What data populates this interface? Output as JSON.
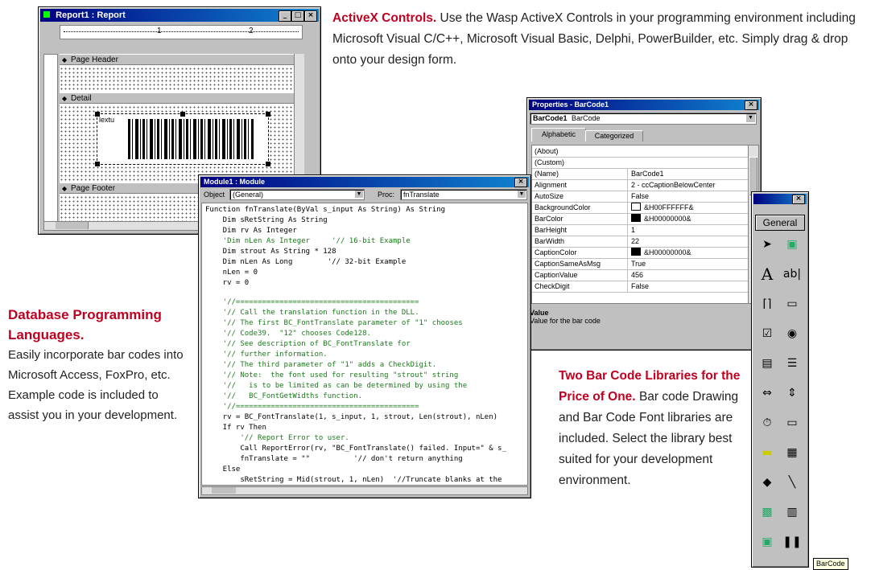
{
  "report_window": {
    "title": "Report1 : Report",
    "ruler_marks": [
      "1",
      "2"
    ],
    "sections": {
      "page_header": "Page Header",
      "detail": "Detail",
      "page_footer": "Page Footer"
    },
    "barcode_control_label": "lextu"
  },
  "activex": {
    "heading": "ActiveX Controls.",
    "text": "Use the Wasp ActiveX Controls in your programming environment including Microsoft Visual C/C++, Microsoft Visual Basic, Delphi, PowerBuilder, etc. Simply drag & drop onto your design form."
  },
  "module_window": {
    "title": "Module1 : Module",
    "object_label": "Object",
    "object_value": "(General)",
    "proc_label": "Proc:",
    "proc_value": "fnTranslate",
    "code_lines": [
      {
        "t": "Function fnTranslate(ByVal s_input As String) As String",
        "c": false
      },
      {
        "t": "    Dim sRetString As String",
        "c": false
      },
      {
        "t": "    Dim rv As Integer",
        "c": false
      },
      {
        "t": "    'Dim nLen As Integer     '// 16-bit Example",
        "c": true
      },
      {
        "t": "    Dim strout As String * 128",
        "c": false
      },
      {
        "t": "    Dim nLen As Long        '// 32-bit Example",
        "c": false
      },
      {
        "t": "    nLen = 0",
        "c": false
      },
      {
        "t": "    rv = 0",
        "c": false
      },
      {
        "t": "",
        "c": false
      },
      {
        "t": "    '//==========================================",
        "c": true
      },
      {
        "t": "    '// Call the translation function in the DLL.",
        "c": true
      },
      {
        "t": "    '// The first BC_FontTranslate parameter of \"1\" chooses",
        "c": true
      },
      {
        "t": "    '// Code39.  \"12\" chooses Code128.",
        "c": true
      },
      {
        "t": "    '// See description of BC_FontTranslate for",
        "c": true
      },
      {
        "t": "    '// further information.",
        "c": true
      },
      {
        "t": "    '// The third parameter of \"1\" adds a CheckDigit.",
        "c": true
      },
      {
        "t": "    '// Note:  the font used for resulting \"strout\" string",
        "c": true
      },
      {
        "t": "    '//   is to be limited as can be determined by using the",
        "c": true
      },
      {
        "t": "    '//   BC_FontGetWidths function.",
        "c": true
      },
      {
        "t": "    '//==========================================",
        "c": true
      },
      {
        "t": "    rv = BC_FontTranslate(1, s_input, 1, strout, Len(strout), nLen)",
        "c": false
      },
      {
        "t": "    If rv Then",
        "c": false
      },
      {
        "t": "        '// Report Error to user.",
        "c": true
      },
      {
        "t": "        Call ReportError(rv, \"BC_FontTranslate() failed. Input=\" & s_",
        "c": false
      },
      {
        "t": "        fnTranslate = \"\"          '// don't return anything",
        "c": false
      },
      {
        "t": "    Else",
        "c": false
      },
      {
        "t": "        sRetString = Mid(strout, 1, nLen)  '//Truncate blanks at the",
        "c": false
      },
      {
        "t": "        fnTranslate = sRetString      'return this to the calling r",
        "c": false
      },
      {
        "t": "    End If",
        "c": false
      },
      {
        "t": "End Function",
        "c": false
      }
    ]
  },
  "properties_window": {
    "title": "Properties - BarCode1",
    "object_name": "BarCode1",
    "object_type": "BarCode",
    "tabs": [
      "Alphabetic",
      "Categorized"
    ],
    "rows": [
      {
        "name": "(About)",
        "value": "",
        "swatch": null
      },
      {
        "name": "(Custom)",
        "value": "",
        "swatch": null
      },
      {
        "name": "(Name)",
        "value": "BarCode1",
        "swatch": null
      },
      {
        "name": "Alignment",
        "value": "2 - ccCaptionBelowCenter",
        "swatch": null
      },
      {
        "name": "AutoSize",
        "value": "False",
        "swatch": null
      },
      {
        "name": "BackgroundColor",
        "value": "&H00FFFFFF&",
        "swatch": "#ffffff"
      },
      {
        "name": "BarColor",
        "value": "&H00000000&",
        "swatch": "#000000"
      },
      {
        "name": "BarHeight",
        "value": "1",
        "swatch": null
      },
      {
        "name": "BarWidth",
        "value": "22",
        "swatch": null
      },
      {
        "name": "CaptionColor",
        "value": "&H00000000&",
        "swatch": "#000000"
      },
      {
        "name": "CaptionSameAsMsg",
        "value": "True",
        "swatch": null
      },
      {
        "name": "CaptionValue",
        "value": "456",
        "swatch": null
      },
      {
        "name": "CheckDigit",
        "value": "False",
        "swatch": null
      }
    ],
    "desc_title": "Value",
    "desc_text": "Value for the bar code"
  },
  "database": {
    "heading": "Database Programming Languages.",
    "text": "Easily incorporate bar codes into Microsoft Access, FoxPro, etc. Example code is included to assist you in your development."
  },
  "libraries": {
    "heading": "Two Bar Code Libraries for the Price of One.",
    "text": "Bar code Drawing and Bar Code Font libraries are included. Select the library best suited for your development environment."
  },
  "toolbox": {
    "tab_label": "General",
    "tools": [
      "pointer-icon",
      "picture-icon",
      "label-icon",
      "textbox-icon",
      "frame-icon",
      "command-button-icon",
      "checkbox-icon",
      "option-button-icon",
      "combobox-icon",
      "listbox-icon",
      "hscrollbar-icon",
      "vscrollbar-icon",
      "timer-icon",
      "shape-icon",
      "dir-list-icon",
      "file-list-icon",
      "shape2-icon",
      "line-icon",
      "image-icon",
      "data-icon",
      "ole-icon",
      "barcode-icon"
    ],
    "tooltip": "BarCode"
  },
  "colors": {
    "heading_red": "#c00020",
    "titlebar_blue": "#000080",
    "window_gray": "#c0c0c0",
    "code_comment_green": "#1a7a1a"
  }
}
